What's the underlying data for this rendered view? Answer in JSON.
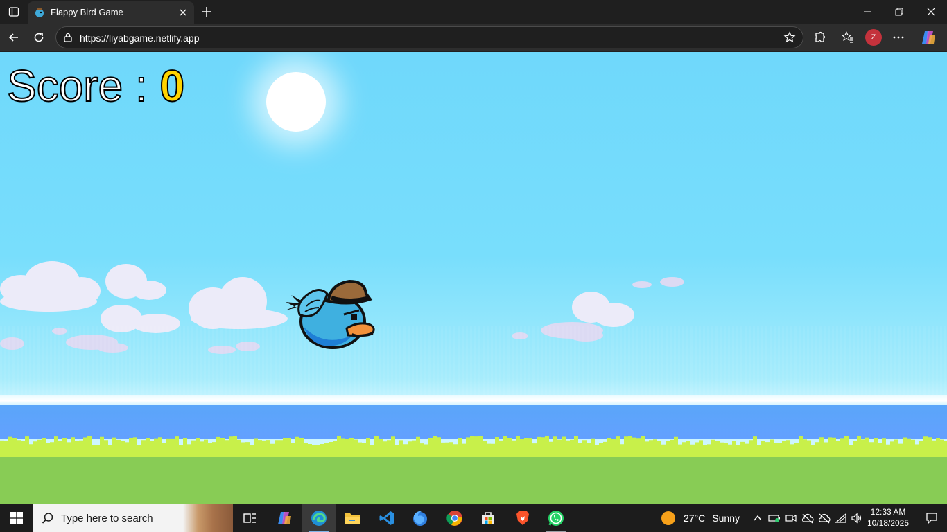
{
  "browser": {
    "tab_title": "Flappy Bird Game",
    "url": "https://liyabgame.netlify.app",
    "profile_initial": "Z",
    "icons": [
      "tab-actions-icon",
      "close-icon",
      "plus-icon",
      "minimize-icon",
      "restore-icon",
      "close-window-icon",
      "back-arrow-icon",
      "refresh-icon",
      "lock-icon",
      "star-icon",
      "extensions-icon",
      "favorites-icon",
      "more-icon",
      "copilot-icon"
    ]
  },
  "game": {
    "score_label": "Score : ",
    "score_value": "0"
  },
  "taskbar": {
    "search_placeholder": "Type here to search",
    "apps": [
      "task-view",
      "copilot",
      "edge",
      "file-explorer",
      "vscode",
      "firefox",
      "chrome",
      "microsoft-store",
      "brave",
      "whatsapp"
    ],
    "weather": {
      "temp": "27°C",
      "condition": "Sunny"
    },
    "time": "12:33 AM",
    "date": "10/18/2025"
  },
  "colors": {
    "sky": "#78defc",
    "water": "#5aa6f9",
    "grass": "#88cc55",
    "score_value": "#ffd400"
  }
}
